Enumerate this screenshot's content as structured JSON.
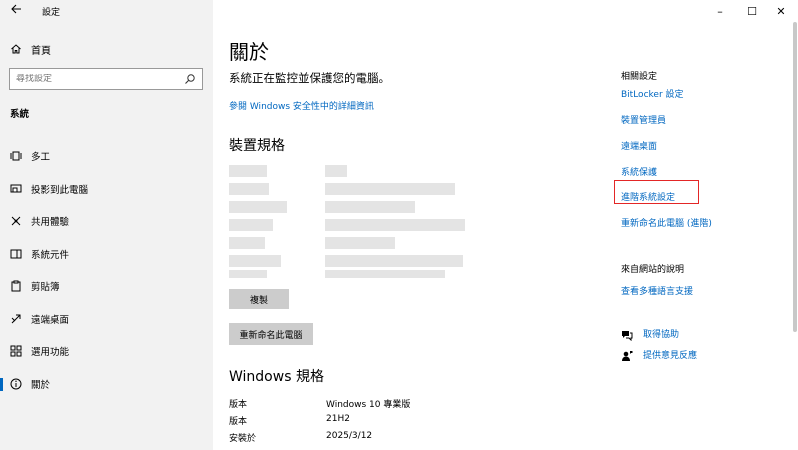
{
  "app": {
    "title": "設定",
    "back_icon": "back-arrow-icon"
  },
  "window_controls": {
    "minimize": "–",
    "maximize": "☐",
    "close": "✕"
  },
  "sidebar": {
    "home_label": "首頁",
    "search_placeholder": "尋找設定",
    "section_label": "系統",
    "items": [
      {
        "label": "多工",
        "icon": "multitasking-icon",
        "active": false
      },
      {
        "label": "投影到此電腦",
        "icon": "projecting-icon",
        "active": false
      },
      {
        "label": "共用體驗",
        "icon": "shared-experiences-icon",
        "active": false
      },
      {
        "label": "系統元件",
        "icon": "system-components-icon",
        "active": false
      },
      {
        "label": "剪貼簿",
        "icon": "clipboard-icon",
        "active": false
      },
      {
        "label": "遠端桌面",
        "icon": "remote-desktop-icon",
        "active": false
      },
      {
        "label": "選用功能",
        "icon": "optional-features-icon",
        "active": false
      },
      {
        "label": "關於",
        "icon": "about-icon",
        "active": true
      }
    ]
  },
  "main": {
    "title": "關於",
    "monitor_text": "系統正在監控並保護您的電腦。",
    "details_link": "參閱 Windows 安全性中的詳細資訊",
    "device_specs_title": "裝置規格",
    "copy_button": "複製",
    "rename_button": "重新命名此電腦",
    "windows_specs_title": "Windows 規格",
    "windows_specs": [
      {
        "label": "版本",
        "value": "Windows 10 專業版"
      },
      {
        "label": "版本",
        "value": "21H2"
      },
      {
        "label": "安裝於",
        "value": "2025/3/12"
      }
    ]
  },
  "related": {
    "heading": "相關設定",
    "links": [
      "BitLocker 設定",
      "裝置管理員",
      "遠端桌面",
      "系統保護",
      "進階系統設定",
      "重新命名此電腦 (進階)"
    ],
    "web_help_heading": "來自網站的說明",
    "web_help_link": "查看多種語言支援",
    "get_help": "取得協助",
    "feedback": "提供意見反應"
  },
  "colors": {
    "accent": "#0067c0",
    "highlight": "#e32626",
    "sidebar_bg": "#f2f2f2"
  }
}
